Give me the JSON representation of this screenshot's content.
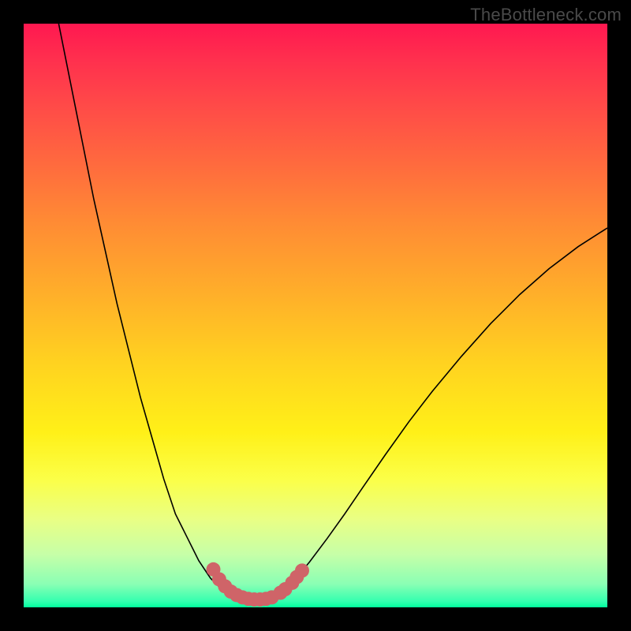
{
  "watermark": "TheBottleneck.com",
  "chart_data": {
    "type": "line",
    "title": "",
    "xlabel": "",
    "ylabel": "",
    "xlim": [
      0,
      100
    ],
    "ylim": [
      0,
      100
    ],
    "grid": false,
    "legend": false,
    "series": [
      {
        "name": "bottleneck-curve",
        "x": [
          6,
          8,
          10,
          12,
          14,
          16,
          18,
          20,
          22,
          24,
          26,
          27,
          28,
          29,
          30,
          31,
          32,
          33,
          34,
          35,
          36,
          37,
          38,
          39,
          40,
          41,
          42,
          43,
          44,
          45,
          47,
          49,
          52,
          55,
          58,
          62,
          66,
          70,
          75,
          80,
          85,
          90,
          95,
          100
        ],
        "y": [
          100,
          90,
          80,
          70,
          61,
          52,
          44,
          36,
          29,
          22,
          16,
          14,
          12,
          10,
          8,
          6.5,
          5,
          4,
          3,
          2.4,
          1.9,
          1.6,
          1.4,
          1.3,
          1.3,
          1.4,
          1.6,
          2,
          2.6,
          3.4,
          5.4,
          7.8,
          11.8,
          16,
          20.4,
          26.2,
          31.8,
          37,
          43,
          48.6,
          53.6,
          58,
          61.8,
          65
        ]
      }
    ],
    "markers": {
      "name": "highlighted-points",
      "color": "#cf6468",
      "size": 9,
      "points": [
        {
          "x": 32.5,
          "y": 6.5
        },
        {
          "x": 33.5,
          "y": 4.8
        },
        {
          "x": 34.5,
          "y": 3.6
        },
        {
          "x": 35.5,
          "y": 2.7
        },
        {
          "x": 36.5,
          "y": 2.1
        },
        {
          "x": 37.5,
          "y": 1.7
        },
        {
          "x": 38.5,
          "y": 1.45
        },
        {
          "x": 39.5,
          "y": 1.35
        },
        {
          "x": 40.5,
          "y": 1.35
        },
        {
          "x": 41.5,
          "y": 1.45
        },
        {
          "x": 42.5,
          "y": 1.7
        },
        {
          "x": 44,
          "y": 2.5
        },
        {
          "x": 44.8,
          "y": 3.1
        },
        {
          "x": 46,
          "y": 4.2
        },
        {
          "x": 46.8,
          "y": 5.2
        },
        {
          "x": 47.7,
          "y": 6.3
        }
      ]
    },
    "gradient_stops": [
      {
        "pos": 0,
        "color": "#ff1850"
      },
      {
        "pos": 6,
        "color": "#ff2f4e"
      },
      {
        "pos": 14,
        "color": "#ff4a48"
      },
      {
        "pos": 24,
        "color": "#ff6a3e"
      },
      {
        "pos": 34,
        "color": "#ff8b34"
      },
      {
        "pos": 46,
        "color": "#ffae2a"
      },
      {
        "pos": 58,
        "color": "#ffd220"
      },
      {
        "pos": 70,
        "color": "#fff018"
      },
      {
        "pos": 78,
        "color": "#fbff47"
      },
      {
        "pos": 85,
        "color": "#e9ff85"
      },
      {
        "pos": 91,
        "color": "#c6ffa8"
      },
      {
        "pos": 96,
        "color": "#8affb4"
      },
      {
        "pos": 99,
        "color": "#33ffaf"
      },
      {
        "pos": 100,
        "color": "#00ff9d"
      }
    ]
  }
}
